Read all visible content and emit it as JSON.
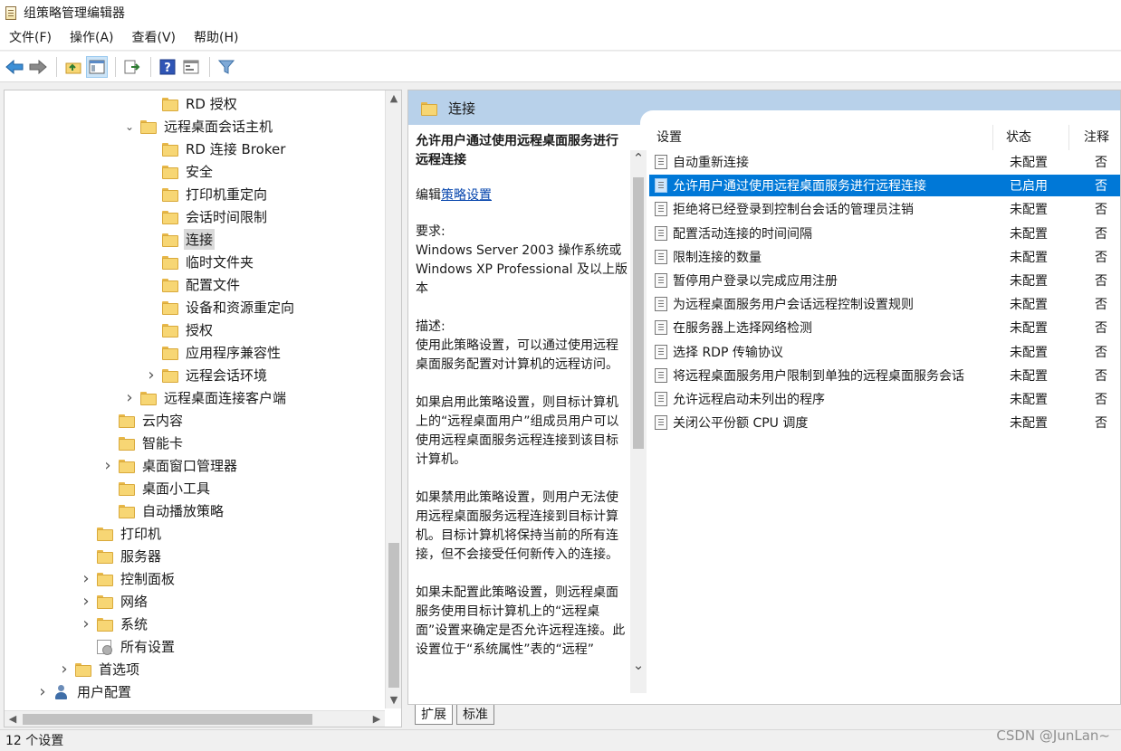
{
  "window": {
    "title": "组策略管理编辑器"
  },
  "menu": [
    "文件(F)",
    "操作(A)",
    "查看(V)",
    "帮助(H)"
  ],
  "toolbar": {
    "icons": [
      "back-icon",
      "forward-icon",
      "up-folder-icon",
      "show-hide-tree-icon",
      "export-list-icon",
      "help-icon",
      "console-icon",
      "filter-icon"
    ]
  },
  "tree": [
    {
      "label": "RD 授权",
      "depth": 3,
      "expander": ""
    },
    {
      "label": "远程桌面会话主机",
      "depth": 2,
      "expander": "v"
    },
    {
      "label": "RD 连接 Broker",
      "depth": 3,
      "expander": ""
    },
    {
      "label": "安全",
      "depth": 3,
      "expander": ""
    },
    {
      "label": "打印机重定向",
      "depth": 3,
      "expander": ""
    },
    {
      "label": "会话时间限制",
      "depth": 3,
      "expander": ""
    },
    {
      "label": "连接",
      "depth": 3,
      "expander": "",
      "selected": true
    },
    {
      "label": "临时文件夹",
      "depth": 3,
      "expander": ""
    },
    {
      "label": "配置文件",
      "depth": 3,
      "expander": ""
    },
    {
      "label": "设备和资源重定向",
      "depth": 3,
      "expander": ""
    },
    {
      "label": "授权",
      "depth": 3,
      "expander": ""
    },
    {
      "label": "应用程序兼容性",
      "depth": 3,
      "expander": ""
    },
    {
      "label": "远程会话环境",
      "depth": 3,
      "expander": ">"
    },
    {
      "label": "远程桌面连接客户端",
      "depth": 2,
      "expander": ">"
    },
    {
      "label": "云内容",
      "depth": 1,
      "expander": ""
    },
    {
      "label": "智能卡",
      "depth": 1,
      "expander": ""
    },
    {
      "label": "桌面窗口管理器",
      "depth": 1,
      "expander": ">"
    },
    {
      "label": "桌面小工具",
      "depth": 1,
      "expander": ""
    },
    {
      "label": "自动播放策略",
      "depth": 1,
      "expander": ""
    },
    {
      "label": "打印机",
      "depth": 0,
      "expander": ""
    },
    {
      "label": "服务器",
      "depth": 0,
      "expander": ""
    },
    {
      "label": "控制面板",
      "depth": 0,
      "expander": ">"
    },
    {
      "label": "网络",
      "depth": 0,
      "expander": ">"
    },
    {
      "label": "系统",
      "depth": 0,
      "expander": ">"
    },
    {
      "label": "所有设置",
      "depth": 0,
      "expander": "",
      "icon": "all-settings"
    },
    {
      "label": "首选项",
      "depth": -1,
      "expander": ">"
    },
    {
      "label": "用户配置",
      "depth": -2,
      "expander": ">",
      "icon": "user"
    }
  ],
  "right_header": "连接",
  "description": {
    "title": "允许用户通过使用远程桌面服务进行远程连接",
    "edit_prefix": "编辑",
    "edit_link": "策略设置",
    "requirements": "要求:\nWindows Server 2003 操作系统或 Windows XP Professional 及以上版本",
    "description_label": "描述:",
    "paragraphs": [
      "使用此策略设置，可以通过使用远程桌面服务配置对计算机的远程访问。",
      "如果启用此策略设置，则目标计算机上的“远程桌面用户”组成员用户可以使用远程桌面服务远程连接到该目标计算机。",
      "如果禁用此策略设置，则用户无法使用远程桌面服务远程连接到目标计算机。目标计算机将保持当前的所有连接，但不会接受任何新传入的连接。",
      "如果未配置此策略设置，则远程桌面服务使用目标计算机上的“远程桌面”设置来确定是否允许远程连接。此设置位于“系统属性”表的“远程”"
    ]
  },
  "settings_columns": [
    "设置",
    "状态",
    "注释"
  ],
  "settings": [
    {
      "name": "自动重新连接",
      "state": "未配置",
      "comment": "否"
    },
    {
      "name": "允许用户通过使用远程桌面服务进行远程连接",
      "state": "已启用",
      "comment": "否",
      "selected": true
    },
    {
      "name": "拒绝将已经登录到控制台会话的管理员注销",
      "state": "未配置",
      "comment": "否"
    },
    {
      "name": "配置活动连接的时间间隔",
      "state": "未配置",
      "comment": "否"
    },
    {
      "name": "限制连接的数量",
      "state": "未配置",
      "comment": "否"
    },
    {
      "name": "暂停用户登录以完成应用注册",
      "state": "未配置",
      "comment": "否"
    },
    {
      "name": "为远程桌面服务用户会话远程控制设置规则",
      "state": "未配置",
      "comment": "否"
    },
    {
      "name": "在服务器上选择网络检测",
      "state": "未配置",
      "comment": "否"
    },
    {
      "name": "选择 RDP 传输协议",
      "state": "未配置",
      "comment": "否"
    },
    {
      "name": "将远程桌面服务用户限制到单独的远程桌面服务会话",
      "state": "未配置",
      "comment": "否"
    },
    {
      "name": "允许远程启动未列出的程序",
      "state": "未配置",
      "comment": "否"
    },
    {
      "name": "关闭公平份额 CPU 调度",
      "state": "未配置",
      "comment": "否"
    }
  ],
  "tabs": [
    "扩展",
    "标准"
  ],
  "statusbar": "12 个设置",
  "watermark": "CSDN @JunLan~",
  "colors": {
    "selection": "#0078d7",
    "header_band": "#b8d1ea",
    "link": "#0645ad"
  }
}
